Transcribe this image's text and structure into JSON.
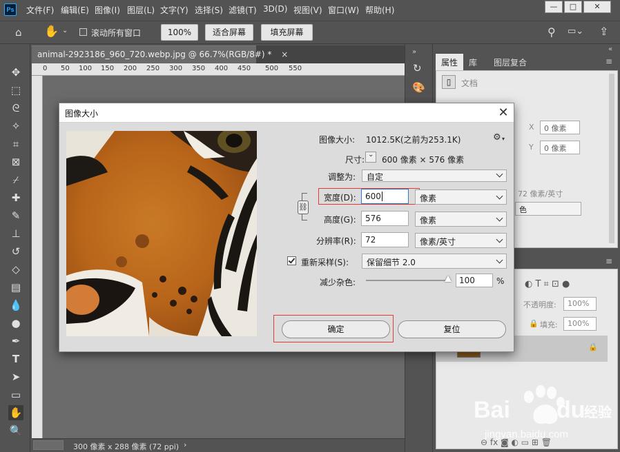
{
  "menubar": {
    "logo": "Ps",
    "items": [
      "文件(F)",
      "编辑(E)",
      "图像(I)",
      "图层(L)",
      "文字(Y)",
      "选择(S)",
      "滤镜(T)",
      "3D(D)",
      "视图(V)",
      "窗口(W)",
      "帮助(H)"
    ],
    "window_controls": [
      "minimize-icon",
      "restore-icon",
      "close-icon"
    ]
  },
  "options": {
    "scroll_all_label": "滚动所有窗口",
    "zoom_btn": "100%",
    "fit_btn": "适合屏幕",
    "fill_btn": "填充屏幕"
  },
  "document": {
    "tab_title": "animal-2923186_960_720.webp.jpg @ 66.7%(RGB/8#) *",
    "ruler_ticks": [
      "0",
      "50",
      "100",
      "150",
      "200",
      "250",
      "300",
      "350",
      "400",
      "450",
      "500",
      "550"
    ],
    "status": "300 像素 x 288 像素 (72 ppi)"
  },
  "right_panel": {
    "tabs": [
      "属性",
      "库",
      "图层复合"
    ],
    "doc_label": "文档",
    "x_label": "X",
    "y_label": "Y",
    "x_value": "0 像素",
    "y_value": "0 像素",
    "resolution_partial": "72 像素/英寸",
    "color_partial": "色",
    "opacity_label": "不透明度:",
    "opacity_value": "100%",
    "fill_label": "填充:",
    "fill_value": "100%"
  },
  "dialog": {
    "title": "图像大小",
    "image_size_label": "图像大小:",
    "image_size_value": "1012.5K(之前为253.1K)",
    "dimensions_label": "尺寸:",
    "dimensions_value": "600 像素 × 576 像素",
    "fit_to_label": "调整为:",
    "fit_to_value": "自定",
    "width_label": "宽度(D):",
    "width_value": "600",
    "width_unit": "像素",
    "height_label": "高度(G):",
    "height_value": "576",
    "height_unit": "像素",
    "resolution_label": "分辨率(R):",
    "resolution_value": "72",
    "resolution_unit": "像素/英寸",
    "resample_label": "重新采样(S):",
    "resample_checked": true,
    "resample_value": "保留细节 2.0",
    "noise_label": "减少杂色:",
    "noise_value": "100",
    "noise_unit": "%",
    "ok_label": "确定",
    "reset_label": "复位"
  },
  "watermark": {
    "brand": "Bai",
    "brand2": "du",
    "brand_cn": "经验",
    "url": "jingyan.baidu.com"
  },
  "colors": {
    "accent_red": "#e23b3b",
    "focus_blue": "#2b7bd6",
    "ui_dark": "#535353"
  }
}
